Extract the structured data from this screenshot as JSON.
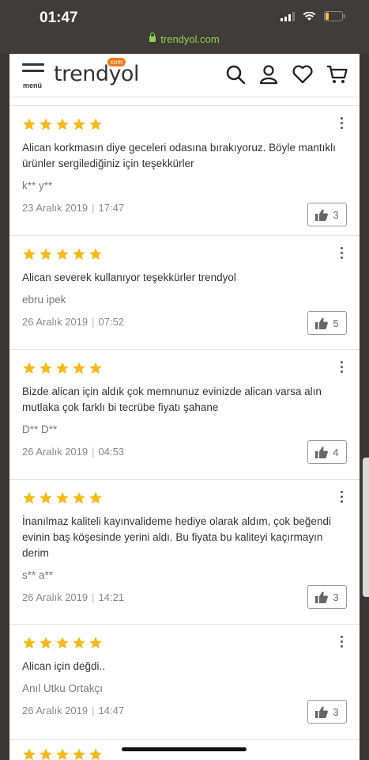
{
  "status": {
    "time": "01:47",
    "url": "trendyol.com"
  },
  "header": {
    "menu_label": "menü",
    "logo": "trendyol",
    "logo_badge": "com"
  },
  "reviews": [
    {
      "stars": 5,
      "text": "Alican korkmasın diye geceleri odasına bırakıyoruz. Böyle mantıklı ürünler sergilediğiniz için teşekkürler",
      "user": "k** y**",
      "date": "23 Aralık 2019",
      "time": "17:47",
      "likes": "3"
    },
    {
      "stars": 5,
      "text": "Alican severek kullanıyor teşekkürler trendyol",
      "user": "ebru ipek",
      "date": "26 Aralık 2019",
      "time": "07:52",
      "likes": "5"
    },
    {
      "stars": 5,
      "text": "Bizde alican için aldık çok memnunuz evinizde alican varsa alın mutlaka çok farklı bi tecrübe fiyatı şahane",
      "user": "D** D**",
      "date": "26 Aralık 2019",
      "time": "04:53",
      "likes": "4"
    },
    {
      "stars": 5,
      "text": "İnanılmaz kaliteli kayınvalideme hediye olarak aldım, çok beğendi evinin baş köşesinde yerini aldı. Bu fiyata bu kaliteyi kaçırmayın derim",
      "user": "s** a**",
      "date": "26 Aralık 2019",
      "time": "14:21",
      "likes": "3"
    },
    {
      "stars": 5,
      "text": "Alican için değdi..",
      "user": "Anıl Utku Ortakçı",
      "date": "26 Aralık 2019",
      "time": "14:47",
      "likes": "3"
    }
  ],
  "colors": {
    "star": "#f5b91a",
    "accent": "#f27a1a",
    "url_green": "#8ed24a"
  },
  "icons": [
    "search-icon",
    "user-icon",
    "heart-icon",
    "cart-icon",
    "thumbs-up-icon",
    "kebab-icon",
    "star-icon"
  ]
}
